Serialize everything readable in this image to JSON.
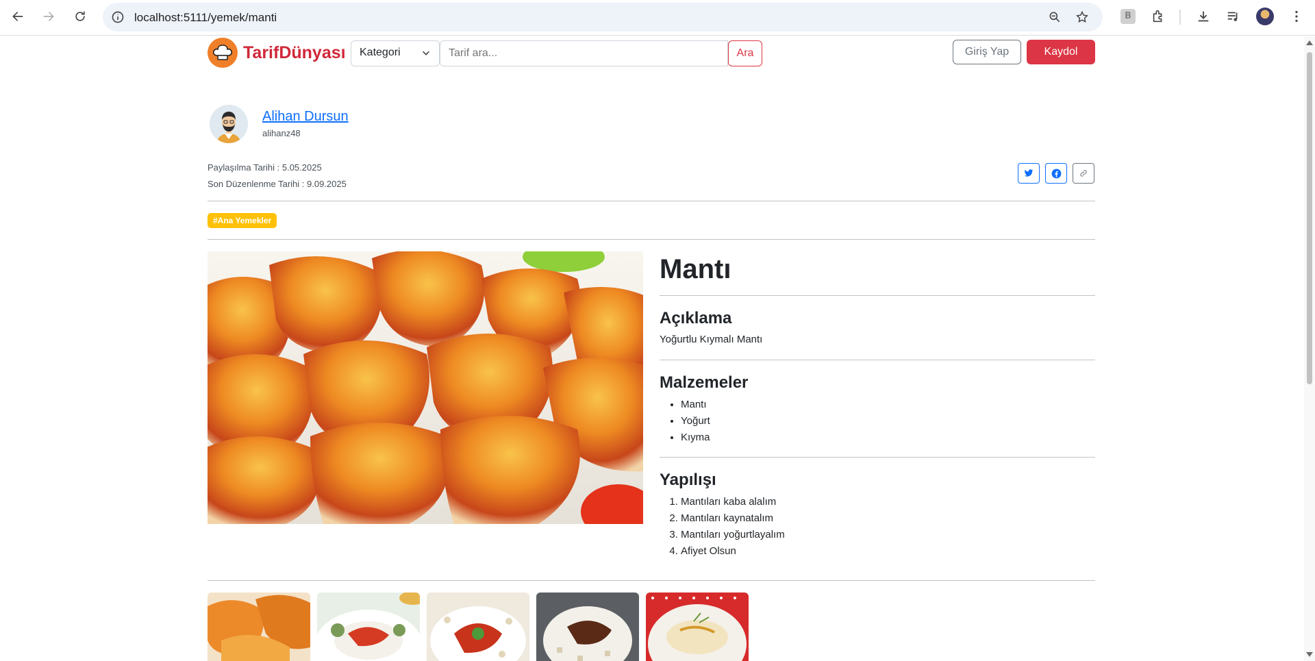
{
  "browser": {
    "url": "localhost:5111/yemek/manti"
  },
  "site": {
    "brand": "TarifDünyası",
    "category_label": "Kategori",
    "search_placeholder": "Tarif ara...",
    "search_button": "Ara",
    "login_button": "Giriş Yap",
    "signup_button": "Kaydol",
    "accent_color": "#dc3545"
  },
  "author": {
    "name": "Alihan Dursun",
    "username": "alihanz48"
  },
  "dates": {
    "shared": "Paylaşılma Tarihi : 5.05.2025",
    "edited": "Son Düzenlenme Tarihi : 9.09.2025"
  },
  "share": {
    "icons": [
      "twitter-icon",
      "facebook-icon",
      "link-icon"
    ]
  },
  "tag": "#Ana Yemekler",
  "recipe": {
    "title": "Mantı",
    "description_heading": "Açıklama",
    "description": "Yoğurtlu Kıymalı Mantı",
    "ingredients_heading": "Malzemeler",
    "ingredients": [
      "Mantı",
      "Yoğurt",
      "Kıyma"
    ],
    "steps_heading": "Yapılışı",
    "steps": [
      "Mantıları kaba alalım",
      "Mantıları kaynatalım",
      "Mantıları yoğurtlayalım",
      "Afiyet Olsun"
    ]
  }
}
